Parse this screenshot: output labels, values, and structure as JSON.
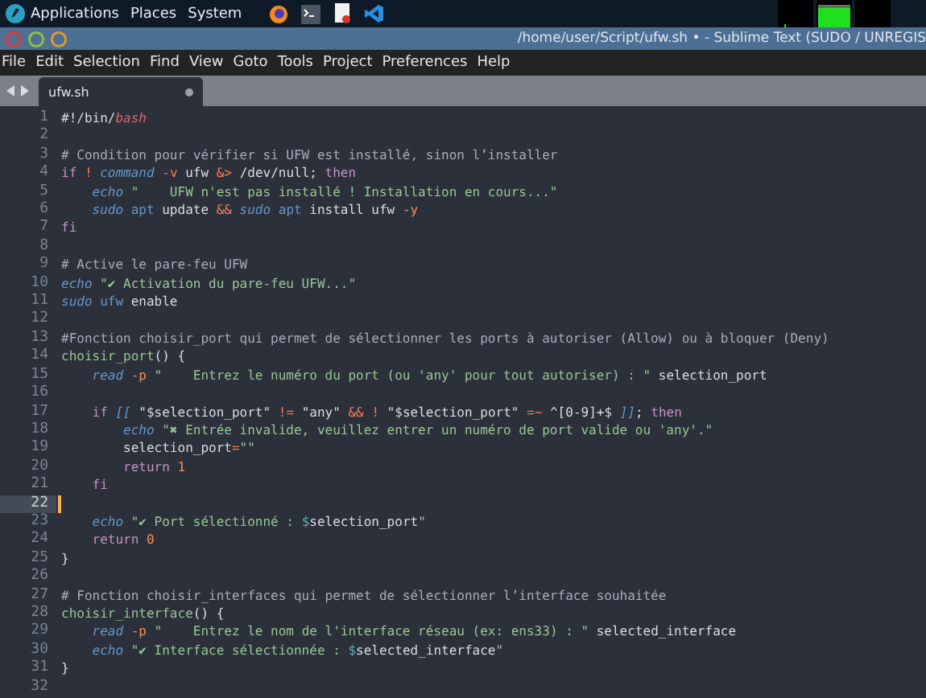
{
  "top_panel": {
    "menus": [
      "Applications",
      "Places",
      "System"
    ]
  },
  "window": {
    "title": "/home/user/Script/ufw.sh • - Sublime Text (SUDO / UNREGIS"
  },
  "menu_bar": [
    "File",
    "Edit",
    "Selection",
    "Find",
    "View",
    "Goto",
    "Tools",
    "Project",
    "Preferences",
    "Help"
  ],
  "tabs": [
    {
      "label": "ufw.sh",
      "selected": true,
      "modified": true
    }
  ],
  "editor": {
    "lines": [
      {
        "number": "1",
        "current": false,
        "tokens": [
          {
            "kind": "plain",
            "text": "#!/bin/"
          },
          {
            "kind": "shell",
            "text": "bash"
          }
        ]
      },
      {
        "number": "2",
        "current": false
      },
      {
        "number": "3",
        "current": false,
        "tokens": [
          {
            "kind": "comment",
            "text": "# Condition pour vérifier si UFW est installé, sinon l’installer"
          }
        ]
      },
      {
        "number": "4",
        "current": false,
        "tokens": [
          {
            "kind": "keyword",
            "text": "if"
          },
          {
            "kind": "operator",
            "text": " ! "
          },
          {
            "kind": "builtin",
            "text": "command"
          },
          {
            "kind": "operator",
            "text": " -v"
          },
          {
            "kind": "plain",
            "text": " ufw "
          },
          {
            "kind": "operator",
            "text": "&>"
          },
          {
            "kind": "plain",
            "text": " /dev/null; "
          },
          {
            "kind": "keyword",
            "text": "then"
          }
        ]
      },
      {
        "number": "5",
        "current": false,
        "tokens": [
          {
            "kind": "builtin",
            "text": "    echo"
          },
          {
            "kind": "string",
            "text": " \"    UFW n'est pas installé ! Installation en cours...\""
          }
        ]
      },
      {
        "number": "6",
        "current": false,
        "tokens": [
          {
            "kind": "builtin",
            "text": "    sudo"
          },
          {
            "kind": "command",
            "text": " apt"
          },
          {
            "kind": "plain",
            "text": " update "
          },
          {
            "kind": "operator",
            "text": "&&"
          },
          {
            "kind": "builtin",
            "text": " sudo"
          },
          {
            "kind": "command",
            "text": " apt"
          },
          {
            "kind": "plain",
            "text": " install ufw "
          },
          {
            "kind": "number",
            "text": "-y"
          }
        ]
      },
      {
        "number": "7",
        "current": false,
        "tokens": [
          {
            "kind": "keyword",
            "text": "fi"
          }
        ]
      },
      {
        "number": "8",
        "current": false
      },
      {
        "number": "9",
        "current": false,
        "tokens": [
          {
            "kind": "comment",
            "text": "# Active le pare-feu UFW"
          }
        ]
      },
      {
        "number": "10",
        "current": false,
        "tokens": [
          {
            "kind": "builtin",
            "text": "echo"
          },
          {
            "kind": "string",
            "text": " \"✔ Activation du pare-feu UFW...\""
          }
        ]
      },
      {
        "number": "11",
        "current": false,
        "tokens": [
          {
            "kind": "builtin",
            "text": "sudo"
          },
          {
            "kind": "command",
            "text": " ufw"
          },
          {
            "kind": "plain",
            "text": " enable"
          }
        ]
      },
      {
        "number": "12",
        "current": false
      },
      {
        "number": "13",
        "current": false,
        "tokens": [
          {
            "kind": "comment",
            "text": "#Fonction choisir_port qui permet de sélectionner les ports à autoriser (Allow) ou à bloquer (Deny)"
          }
        ]
      },
      {
        "number": "14",
        "current": false,
        "tokens": [
          {
            "kind": "function",
            "text": "choisir_port"
          },
          {
            "kind": "plain",
            "text": "() {"
          }
        ]
      },
      {
        "number": "15",
        "current": false,
        "tokens": [
          {
            "kind": "builtin",
            "text": "    read"
          },
          {
            "kind": "number",
            "text": " -p"
          },
          {
            "kind": "string",
            "text": " \"    Entrez le numéro du port (ou 'any' pour tout autoriser) : \""
          },
          {
            "kind": "plain",
            "text": " selection_port"
          }
        ]
      },
      {
        "number": "16",
        "current": false
      },
      {
        "number": "17",
        "current": false,
        "tokens": [
          {
            "kind": "keyword",
            "text": "    if"
          },
          {
            "kind": "builtin",
            "text": " [["
          },
          {
            "kind": "plain",
            "text": " \"$selection_port\" "
          },
          {
            "kind": "operator",
            "text": "!="
          },
          {
            "kind": "plain",
            "text": " \"any\" "
          },
          {
            "kind": "operator",
            "text": "&&"
          },
          {
            "kind": "operator",
            "text": " !"
          },
          {
            "kind": "plain",
            "text": " \"$selection_port\" "
          },
          {
            "kind": "operator",
            "text": "=~"
          },
          {
            "kind": "plain",
            "text": " ^[0-9]+$ "
          },
          {
            "kind": "builtin",
            "text": "]]"
          },
          {
            "kind": "plain",
            "text": "; "
          },
          {
            "kind": "keyword",
            "text": "then"
          }
        ]
      },
      {
        "number": "18",
        "current": false,
        "tokens": [
          {
            "kind": "builtin",
            "text": "        echo"
          },
          {
            "kind": "string",
            "text": " \"✖ Entrée invalide, veuillez entrer un numéro de port valide ou 'any'.\""
          }
        ]
      },
      {
        "number": "19",
        "current": false,
        "tokens": [
          {
            "kind": "plain",
            "text": "        selection_port"
          },
          {
            "kind": "operator",
            "text": "="
          },
          {
            "kind": "string",
            "text": "\"\""
          }
        ]
      },
      {
        "number": "20",
        "current": false,
        "tokens": [
          {
            "kind": "keyword",
            "text": "        return"
          },
          {
            "kind": "number",
            "text": " 1"
          }
        ]
      },
      {
        "number": "21",
        "current": false,
        "tokens": [
          {
            "kind": "keyword",
            "text": "    fi"
          }
        ]
      },
      {
        "number": "22",
        "current": true
      },
      {
        "number": "23",
        "current": false,
        "tokens": [
          {
            "kind": "builtin",
            "text": "    echo"
          },
          {
            "kind": "string",
            "text": " \"✔ Port sélectionné : "
          },
          {
            "kind": "variable",
            "text": "$"
          },
          {
            "kind": "plain",
            "text": "selection_port"
          },
          {
            "kind": "string",
            "text": "\""
          }
        ]
      },
      {
        "number": "24",
        "current": false,
        "tokens": [
          {
            "kind": "keyword",
            "text": "    return"
          },
          {
            "kind": "number",
            "text": " 0"
          }
        ]
      },
      {
        "number": "25",
        "current": false,
        "tokens": [
          {
            "kind": "plain",
            "text": "}"
          }
        ]
      },
      {
        "number": "26",
        "current": false
      },
      {
        "number": "27",
        "current": false,
        "tokens": [
          {
            "kind": "comment",
            "text": "# Fonction choisir_interfaces qui permet de sélectionner l’interface souhaitée"
          }
        ]
      },
      {
        "number": "28",
        "current": false,
        "tokens": [
          {
            "kind": "function",
            "text": "choisir_interface"
          },
          {
            "kind": "plain",
            "text": "() {"
          }
        ]
      },
      {
        "number": "29",
        "current": false,
        "tokens": [
          {
            "kind": "builtin",
            "text": "    read"
          },
          {
            "kind": "number",
            "text": " -p"
          },
          {
            "kind": "string",
            "text": " \"    Entrez le nom de l'interface réseau (ex: ens33) : \""
          },
          {
            "kind": "plain",
            "text": " selected_interface"
          }
        ]
      },
      {
        "number": "30",
        "current": false,
        "tokens": [
          {
            "kind": "builtin",
            "text": "    echo"
          },
          {
            "kind": "string",
            "text": " \"✔ Interface sélectionnée : "
          },
          {
            "kind": "variable",
            "text": "$"
          },
          {
            "kind": "plain",
            "text": "selected_interface"
          },
          {
            "kind": "string",
            "text": "\""
          }
        ]
      },
      {
        "number": "31",
        "current": false,
        "tokens": [
          {
            "kind": "plain",
            "text": "}"
          }
        ]
      },
      {
        "number": "32",
        "current": false
      }
    ]
  }
}
